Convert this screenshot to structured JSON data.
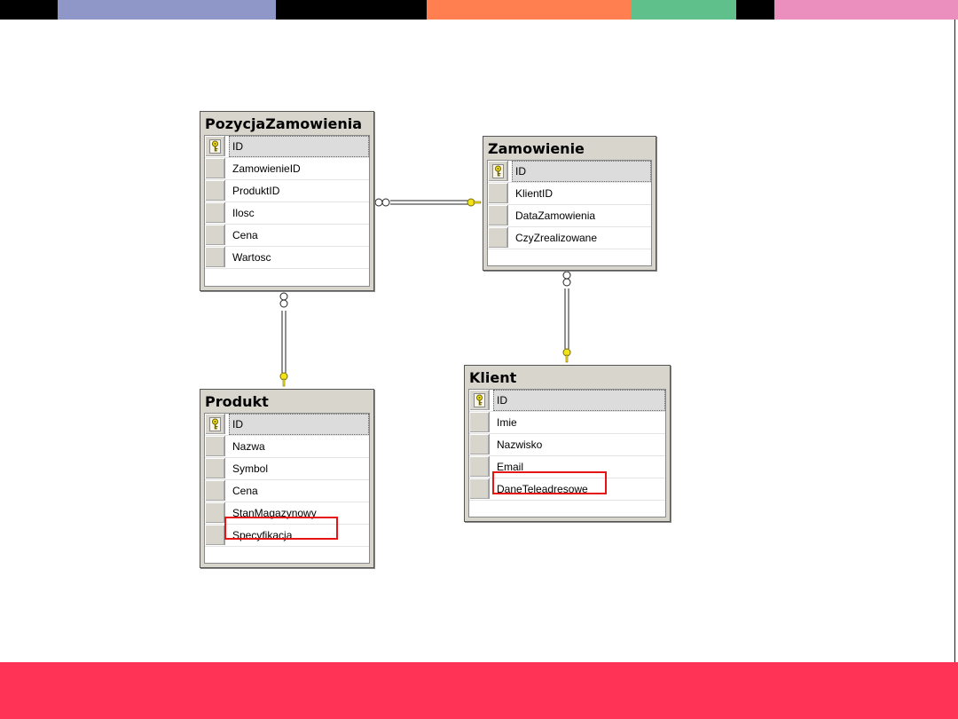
{
  "colors": {
    "topbar": [
      "#000000",
      "#8f97c9",
      "#000000",
      "#ff7f50",
      "#5fc08c",
      "#000000",
      "#eb8fbf"
    ],
    "footer": "#ff3355",
    "highlight": "#e81414",
    "key": "#f2e41a"
  },
  "tables": {
    "pozycja": {
      "title": "PozycjaZamowienia",
      "columns": [
        "ID",
        "ZamowienieID",
        "ProduktID",
        "Ilosc",
        "Cena",
        "Wartosc"
      ]
    },
    "zamowienie": {
      "title": "Zamowienie",
      "columns": [
        "ID",
        "KlientID",
        "DataZamowienia",
        "CzyZrealizowane"
      ]
    },
    "produkt": {
      "title": "Produkt",
      "columns": [
        "ID",
        "Nazwa",
        "Symbol",
        "Cena",
        "StanMagazynowy",
        "Specyfikacja"
      ]
    },
    "klient": {
      "title": "Klient",
      "columns": [
        "ID",
        "Imie",
        "Nazwisko",
        "Email",
        "DaneTeleadresowe"
      ]
    }
  },
  "primary_key_icon": "key-icon",
  "relationship_icons": [
    "infinity-icon",
    "key-icon"
  ],
  "highlighted_columns": [
    "Produkt.Specyfikacja",
    "Klient.DaneTeleadresowe"
  ]
}
